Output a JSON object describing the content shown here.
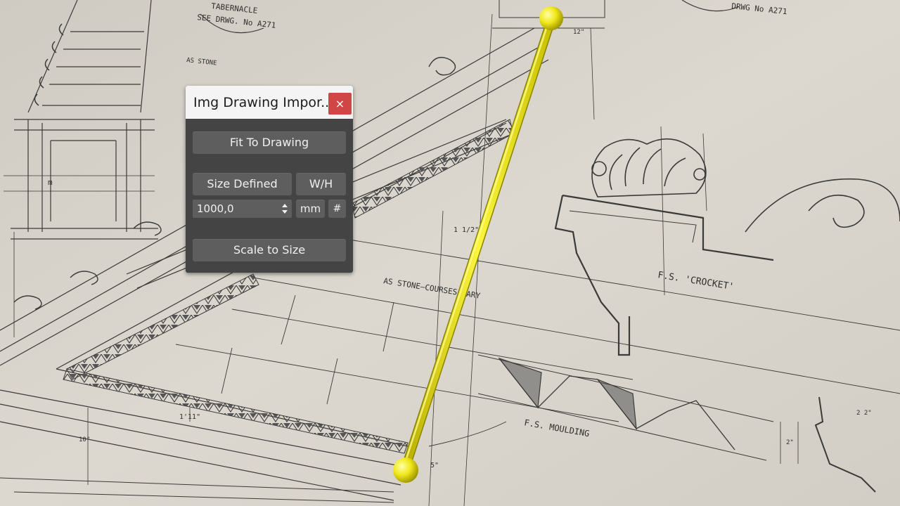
{
  "dialog": {
    "title": "Img Drawing Impor...",
    "close_glyph": "×",
    "fit_button": "Fit To Drawing",
    "size_mode_button": "Size Defined",
    "wh_button": "W/H",
    "size_value": "1000,0",
    "unit_button": "mm",
    "hash_button": "#",
    "scale_button": "Scale to Size"
  },
  "blueprint": {
    "labels": {
      "tabernacle": "TABERNACLE",
      "see_drwg": "SEE DRWG. No A271",
      "drwg_no": "DRWG No A271",
      "as_stone": "AS STONE",
      "as_stone_courses": "AS STONE—COURSES VARY",
      "fs_crocket": "F.S. 'CROCKET'",
      "fs_moulding": "F.S. MOULDING",
      "dim_1_1_2": "1 1/2\"",
      "dim_1_11": "1'11\"",
      "dim_5": "5\"",
      "dim_10": "10\"",
      "dim_12": "12\"",
      "dim_2": "2\"",
      "dim_22": "2 2\"",
      "dim_m": "m"
    }
  },
  "measure_tool": {
    "color": "#f2ea1c"
  },
  "colors": {
    "paper": "#d9d5cd",
    "ink": "#3a3a38",
    "dialog_bg": "#444444",
    "button_bg": "#5e5e5e",
    "close_bg": "#d04545"
  }
}
